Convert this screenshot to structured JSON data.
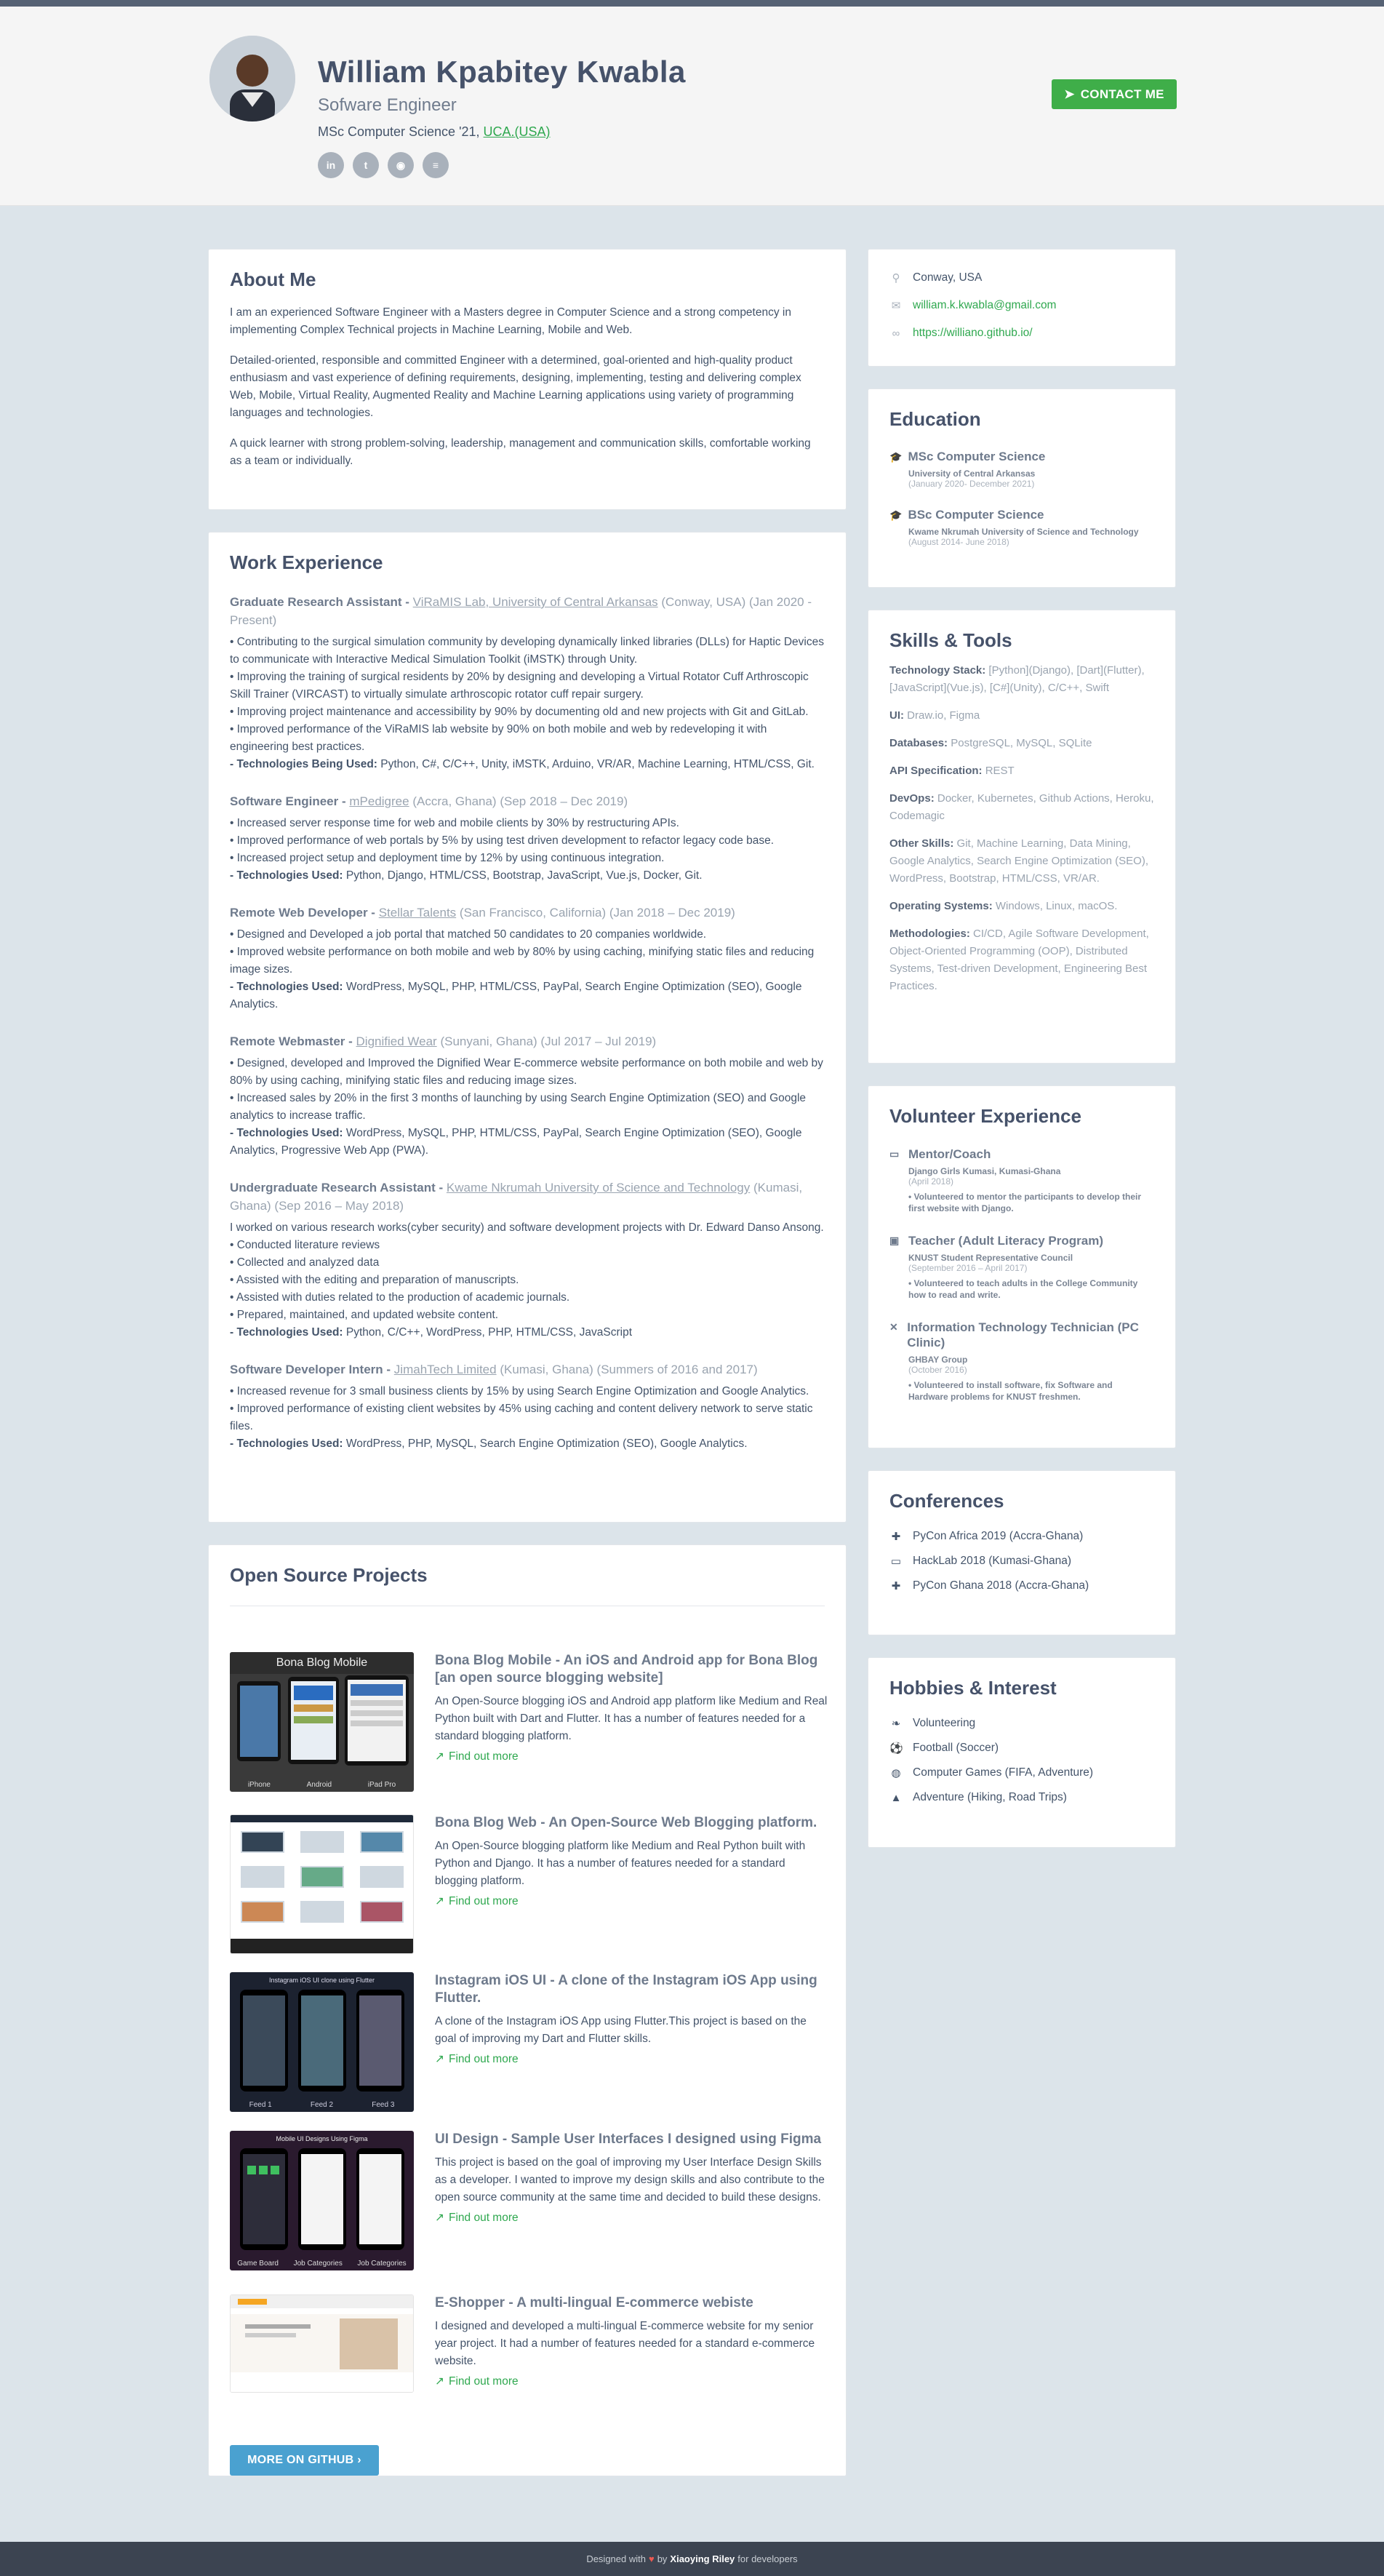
{
  "header": {
    "name": "William Kpabitey Kwabla",
    "tagline": "Sofware Engineer",
    "degree_prefix": "MSc Computer Science '21,",
    "degree_link": "UCA.(USA)",
    "contact_label": "CONTACT ME",
    "socials": [
      {
        "icon": "linkedin-icon",
        "glyph": "in"
      },
      {
        "icon": "twitter-icon",
        "glyph": "t"
      },
      {
        "icon": "github-icon",
        "glyph": "◉"
      },
      {
        "icon": "stackoverflow-icon",
        "glyph": "≡"
      }
    ]
  },
  "about": {
    "heading": "About Me",
    "paragraphs": [
      "I am an experienced Software Engineer with a Masters degree in Computer Science and a strong competency in implementing Complex Technical projects in Machine Learning, Mobile and Web.",
      "Detailed-oriented, responsible and committed Engineer with a determined, goal-oriented and high-quality product enthusiasm and vast experience of defining requirements, designing, implementing, testing and delivering complex Web, Mobile, Virtual Reality, Augmented Reality and Machine Learning applications using variety of programming languages and technologies.",
      "A quick learner with strong problem-solving, leadership, management and communication skills, comfortable working as a team or individually."
    ]
  },
  "work": {
    "heading": "Work Experience",
    "jobs": [
      {
        "title": "Graduate Research Assistant -",
        "org": "ViRaMIS Lab, University of Central Arkansas",
        "meta": "(Conway, USA) (Jan 2020 - Present)",
        "lines": [
          "• Contributing to the surgical simulation community by developing dynamically linked libraries (DLLs) for Haptic Devices to communicate with Interactive Medical Simulation Toolkit (iMSTK) through Unity.",
          "• Improving the training of surgical residents by 20% by designing and developing a Virtual Rotator Cuff Arthroscopic Skill Trainer (VIRCAST) to virtually simulate arthroscopic rotator cuff repair surgery.",
          "• Improving project maintenance and accessibility by 90% by documenting old and new projects with Git and GitLab.",
          "• Improved performance of the ViRaMIS lab website by 90% on both mobile and web by redeveloping it with engineering best practices."
        ],
        "tech_label": "- Technologies Being Used:",
        "tech": "Python, C#, C/C++, Unity, iMSTK, Arduino, VR/AR, Machine Learning, HTML/CSS, Git."
      },
      {
        "title": "Software Engineer -",
        "org": "mPedigree",
        "meta": "(Accra, Ghana) (Sep 2018 – Dec 2019)",
        "lines": [
          "• Increased server response time for web and mobile clients by 30% by restructuring APIs.",
          "• Improved performance of web portals by 5% by using test driven development to refactor legacy code base.",
          "• Increased project setup and deployment time by 12% by using continuous integration."
        ],
        "tech_label": "- Technologies Used:",
        "tech": "Python, Django, HTML/CSS, Bootstrap, JavaScript, Vue.js, Docker, Git."
      },
      {
        "title": "Remote Web Developer -",
        "org": "Stellar Talents",
        "meta": "(San Francisco, California) (Jan 2018 – Dec 2019)",
        "lines": [
          "• Designed and Developed a job portal that matched 50 candidates to 20 companies worldwide.",
          "• Improved website performance on both mobile and web by 80% by using caching, minifying static files and reducing image sizes."
        ],
        "tech_label": "- Technologies Used:",
        "tech": "WordPress, MySQL, PHP, HTML/CSS, PayPal, Search Engine Optimization (SEO), Google Analytics."
      },
      {
        "title": "Remote Webmaster -",
        "org": "Dignified Wear",
        "meta": "(Sunyani, Ghana) (Jul 2017 – Jul 2019)",
        "lines": [
          "• Designed, developed and Improved the Dignified Wear E-commerce website performance on both mobile and web by 80% by using caching, minifying static files and reducing image sizes.",
          "• Increased sales by 20% in the first 3 months of launching by using Search Engine Optimization (SEO) and Google analytics to increase traffic."
        ],
        "tech_label": "- Technologies Used:",
        "tech": "WordPress, MySQL, PHP, HTML/CSS, PayPal, Search Engine Optimization (SEO), Google Analytics, Progressive Web App (PWA)."
      },
      {
        "title": "Undergraduate Research Assistant -",
        "org": "Kwame Nkrumah University of Science and Technology",
        "meta": "(Kumasi, Ghana) (Sep 2016 – May 2018)",
        "lines": [
          "I worked on various research works(cyber security) and software development projects with Dr. Edward Danso Ansong.",
          "• Conducted literature reviews",
          "• Collected and analyzed data",
          "• Assisted with the editing and preparation of manuscripts.",
          "• Assisted with duties related to the production of academic journals.",
          "• Prepared, maintained, and updated website content."
        ],
        "tech_label": "- Technologies Used:",
        "tech": "Python, C/C++, WordPress, PHP, HTML/CSS, JavaScript"
      },
      {
        "title": "Software Developer Intern -",
        "org": "JimahTech Limited",
        "meta": "(Kumasi, Ghana) (Summers of 2016 and 2017)",
        "lines": [
          "• Increased revenue for 3 small business clients by 15% by using Search Engine Optimization and Google Analytics.",
          "• Improved performance of existing client websites by 45% using caching and content delivery network to serve static files."
        ],
        "tech_label": "- Technologies Used:",
        "tech": "WordPress, PHP, MySQL, Search Engine Optimization (SEO), Google Analytics."
      }
    ]
  },
  "projects": {
    "heading": "Open Source Projects",
    "find_more": "Find out more",
    "github_button": "MORE ON GITHUB ›",
    "items": [
      {
        "title": "Bona Blog Mobile - An iOS and Android app for Bona Blog [an open source blogging website]",
        "desc": "An Open-Source blogging iOS and Android app platform like Medium and Real Python built with Dart and Flutter. It has a number of features needed for a standard blogging platform.",
        "thumb_title": "Bona Blog Mobile",
        "thumb_captions": [
          "iPhone",
          "Android",
          "iPad Pro"
        ]
      },
      {
        "title": "Bona Blog Web - An Open-Source Web Blogging platform.",
        "desc": "An Open-Source blogging platform like Medium and Real Python built with Python and Django. It has a number of features needed for a standard blogging platform.",
        "thumb_title": "",
        "thumb_captions": []
      },
      {
        "title": "Instagram iOS UI - A clone of the Instagram iOS App using Flutter.",
        "desc": "A clone of the Instagram iOS App using Flutter.This project is based on the goal of improving my Dart and Flutter skills.",
        "thumb_title": "Instagram iOS UI clone using Flutter",
        "thumb_captions": [
          "Feed 1",
          "Feed 2",
          "Feed 3"
        ]
      },
      {
        "title": "UI Design - Sample User Interfaces I designed using Figma",
        "desc": "This project is based on the goal of improving my User Interface Design Skills as a developer. I wanted to improve my design skills and also contribute to the open source community at the same time and decided to build these designs.",
        "thumb_title": "Mobile UI Designs Using Figma",
        "thumb_captions": [
          "Game Board",
          "Job Categories",
          "Job Categories"
        ]
      },
      {
        "title": "E-Shopper - A multi-lingual E-commerce webiste",
        "desc": "I designed and developed a multi-lingual E-commerce website for my senior year project. It had a number of features needed for a standard e-commerce website.",
        "thumb_title": "",
        "thumb_captions": []
      }
    ]
  },
  "contact_info": {
    "location": "Conway, USA",
    "email": "william.k.kwabla@gmail.com",
    "website": "https://williano.github.io/"
  },
  "education": {
    "heading": "Education",
    "items": [
      {
        "degree": "MSc Computer Science",
        "school": "University of Central Arkansas",
        "date": "(January 2020- December 2021)"
      },
      {
        "degree": "BSc Computer Science",
        "school": "Kwame Nkrumah University of Science and Technology",
        "date": "(August 2014- June 2018)"
      }
    ]
  },
  "skills": {
    "heading": "Skills & Tools",
    "items": [
      {
        "label": "Technology Stack:",
        "value": "[Python](Django), [Dart](Flutter), [JavaScript](Vue.js), [C#](Unity), C/C++, Swift"
      },
      {
        "label": "UI:",
        "value": "Draw.io, Figma"
      },
      {
        "label": "Databases:",
        "value": "PostgreSQL, MySQL, SQLite"
      },
      {
        "label": "API Specification:",
        "value": "REST"
      },
      {
        "label": "DevOps:",
        "value": "Docker, Kubernetes, Github Actions, Heroku, Codemagic"
      },
      {
        "label": "Other Skills:",
        "value": "Git, Machine Learning, Data Mining, Google Analytics, Search Engine Optimization (SEO), WordPress, Bootstrap, HTML/CSS, VR/AR."
      },
      {
        "label": "Operating Systems:",
        "value": "Windows, Linux, macOS."
      },
      {
        "label": "Methodologies:",
        "value": "CI/CD, Agile Software Development, Object-Oriented Programming (OOP), Distributed Systems, Test-driven Development, Engineering Best Practices."
      }
    ]
  },
  "volunteer": {
    "heading": "Volunteer Experience",
    "items": [
      {
        "role": "Mentor/Coach",
        "org": "Django Girls Kumasi, Kumasi-Ghana",
        "date": "(April 2018)",
        "desc": "• Volunteered to mentor the participants to develop their first website with Django.",
        "icon": "laptop-icon",
        "glyph": "▭"
      },
      {
        "role": "Teacher (Adult Literacy Program)",
        "org": "KNUST Student Representative Council",
        "date": "(September 2016 – April 2017)",
        "desc": "• Volunteered to teach adults in the College Community how to read and write.",
        "icon": "chalkboard-icon",
        "glyph": "▣"
      },
      {
        "role": "Information Technology Technician (PC Clinic)",
        "org": "GHBAY Group",
        "date": "(October 2016)",
        "desc": "• Volunteered to install software, fix Software and Hardware problems for KNUST freshmen.",
        "icon": "tools-icon",
        "glyph": "✕"
      }
    ]
  },
  "conferences": {
    "heading": "Conferences",
    "items": [
      {
        "label": "PyCon Africa 2019 (Accra-Ghana)",
        "icon": "python-icon",
        "glyph": "✚"
      },
      {
        "label": "HackLab 2018 (Kumasi-Ghana)",
        "icon": "laptop-icon",
        "glyph": "▭"
      },
      {
        "label": "PyCon Ghana 2018 (Accra-Ghana)",
        "icon": "python-icon",
        "glyph": "✚"
      }
    ]
  },
  "hobbies": {
    "heading": "Hobbies & Interest",
    "items": [
      {
        "label": "Volunteering",
        "icon": "handshake-icon",
        "glyph": "❧"
      },
      {
        "label": "Football (Soccer)",
        "icon": "football-icon",
        "glyph": "⚽"
      },
      {
        "label": "Computer Games (FIFA, Adventure)",
        "icon": "gamepad-icon",
        "glyph": "◍"
      },
      {
        "label": "Adventure (Hiking, Road Trips)",
        "icon": "mountain-icon",
        "glyph": "▲"
      }
    ]
  },
  "footer": {
    "prefix": "Designed with",
    "by": "by",
    "author": "Xiaoying Riley",
    "suffix": "for developers"
  },
  "colors": {
    "accent": "#3fae49",
    "link": "#2fa84f",
    "heading": "#46526a",
    "page_bg": "#dce4ea",
    "github_button": "#4aa1d0",
    "footer_bg": "#3c4451"
  }
}
